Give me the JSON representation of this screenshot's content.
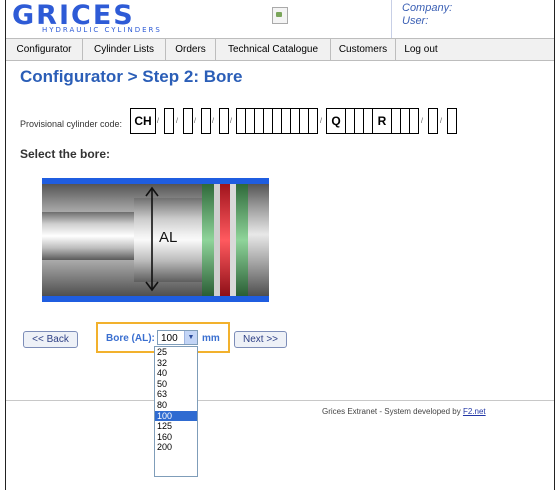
{
  "header": {
    "logo_main": "GRICES",
    "logo_sub": "HYDRAULIC CYLINDERS",
    "company_label": "Company:",
    "user_label": "User:"
  },
  "nav": [
    "Configurator",
    "Cylinder Lists",
    "Orders",
    "Technical Catalogue",
    "Customers",
    "Log out"
  ],
  "page_title": "Configurator > Step 2: Bore",
  "code": {
    "label": "Provisional cylinder code:",
    "first": "CH",
    "q": "Q",
    "r": "R"
  },
  "select_bore_label": "Select the bore:",
  "diagram_label": "AL",
  "buttons": {
    "back": "<< Back",
    "next": "Next >>"
  },
  "bore": {
    "label": "Bore (AL):",
    "selected": "100",
    "unit": "mm",
    "options": [
      "25",
      "32",
      "40",
      "50",
      "63",
      "80",
      "100",
      "125",
      "160",
      "200"
    ]
  },
  "footer": {
    "text": "Grices Extranet - System developed by ",
    "link": "F2.net"
  },
  "colors": {
    "accent": "#2b5eb7",
    "highlight_border": "#f2b12d",
    "selected_option": "#2f6bd1"
  }
}
